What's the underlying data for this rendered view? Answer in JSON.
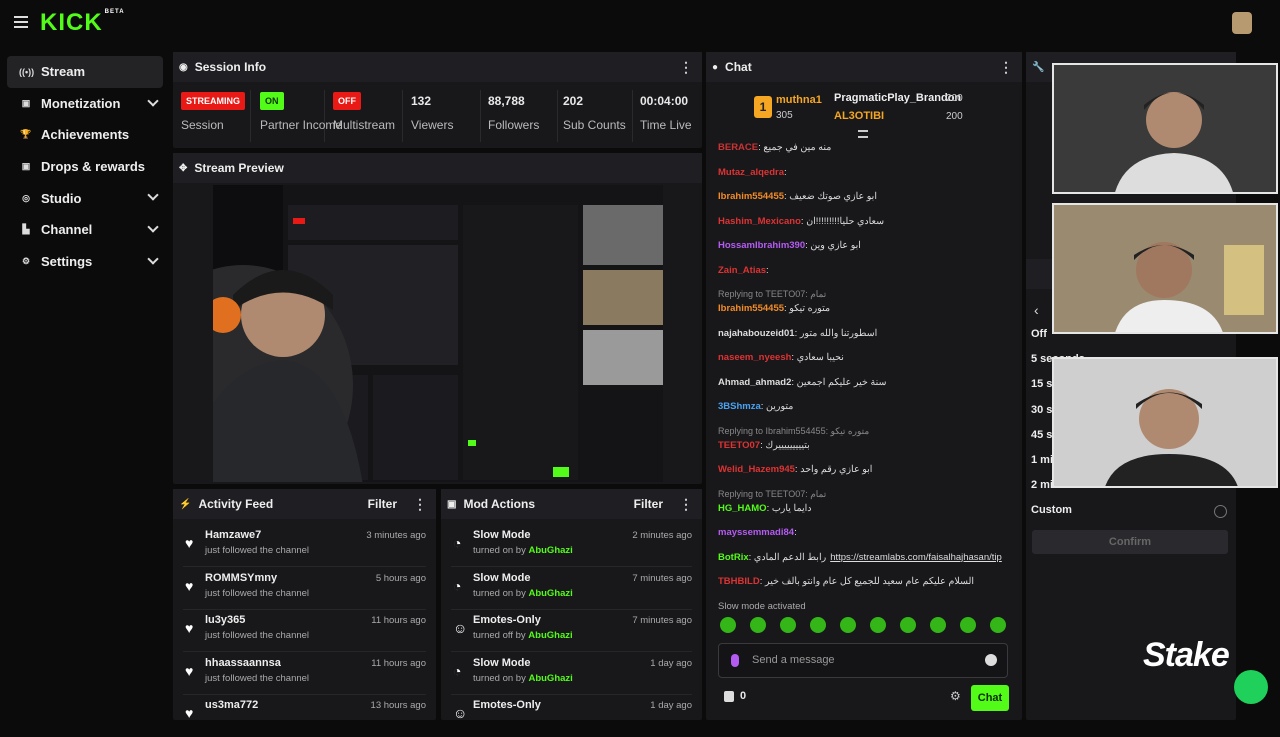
{
  "app": {
    "logo": "KICK",
    "beta": "BETA"
  },
  "sidebar": {
    "items": [
      {
        "label": "Stream",
        "icon": "broadcast-icon",
        "chevron": false
      },
      {
        "label": "Monetization",
        "icon": "money-icon",
        "chevron": true
      },
      {
        "label": "Achievements",
        "icon": "trophy-icon",
        "chevron": false
      },
      {
        "label": "Drops & rewards",
        "icon": "gift-icon",
        "chevron": false
      },
      {
        "label": "Studio",
        "icon": "studio-icon",
        "chevron": true
      },
      {
        "label": "Channel",
        "icon": "channel-icon",
        "chevron": true
      },
      {
        "label": "Settings",
        "icon": "gear-icon",
        "chevron": true
      }
    ]
  },
  "session": {
    "title": "Session Info",
    "stats": [
      {
        "value": "STREAMING",
        "label": "Session",
        "kind": "badge-red"
      },
      {
        "value": "ON",
        "label": "Partner Income",
        "kind": "badge-green"
      },
      {
        "value": "OFF",
        "label": "Multistream",
        "kind": "badge-red"
      },
      {
        "value": "132",
        "label": "Viewers",
        "kind": "text"
      },
      {
        "value": "88,788",
        "label": "Followers",
        "kind": "text"
      },
      {
        "value": "202",
        "label": "Sub Counts",
        "kind": "text"
      },
      {
        "value": "00:04:00",
        "label": "Time Live",
        "kind": "text"
      }
    ]
  },
  "preview": {
    "title": "Stream Preview"
  },
  "activity": {
    "title": "Activity Feed",
    "filter": "Filter",
    "items": [
      {
        "name": "Hamzawe7",
        "action": "just followed the channel",
        "time": "3 minutes ago"
      },
      {
        "name": "ROMMSYmny",
        "action": "just followed the channel",
        "time": "5 hours ago"
      },
      {
        "name": "lu3y365",
        "action": "just followed the channel",
        "time": "11 hours ago"
      },
      {
        "name": "hhaassaannsa",
        "action": "just followed the channel",
        "time": "11 hours ago"
      },
      {
        "name": "us3ma772",
        "action": "",
        "time": "13 hours ago"
      }
    ]
  },
  "mod": {
    "title": "Mod Actions",
    "filter": "Filter",
    "items": [
      {
        "name": "Slow Mode",
        "action": "turned on by",
        "by": "AbuGhazi",
        "time": "2 minutes ago"
      },
      {
        "name": "Slow Mode",
        "action": "turned on by",
        "by": "AbuGhazi",
        "time": "7 minutes ago"
      },
      {
        "name": "Emotes-Only",
        "action": "turned off by",
        "by": "AbuGhazi",
        "time": "7 minutes ago"
      },
      {
        "name": "Slow Mode",
        "action": "turned on by",
        "by": "AbuGhazi",
        "time": "1 day ago"
      },
      {
        "name": "Emotes-Only",
        "action": "",
        "by": "",
        "time": "1 day ago"
      }
    ]
  },
  "chat": {
    "title": "Chat",
    "pinned": {
      "rank": "1",
      "user1": "muthna1",
      "user1_count": "305",
      "user2": "PragmaticPlay_Brandon",
      "user2_count": "200",
      "user3": "AL3OTIBI",
      "user3_count": "200"
    },
    "messages": [
      {
        "user": "BERACE",
        "color": "#c33",
        "text": "منه مين في جميع",
        "reply": ""
      },
      {
        "user": "Mutaz_alqedra",
        "color": "#d33",
        "text": "",
        "reply": ""
      },
      {
        "user": "Ibrahim554455",
        "color": "#f28c28",
        "text": "ابو عازي صوتك ضعيف",
        "reply": ""
      },
      {
        "user": "Hashim_Mexicano",
        "color": "#d33",
        "text": "سعادي حليا!!!!!!!!!ان",
        "reply": ""
      },
      {
        "user": "HossamIbrahim390",
        "color": "#b45cf2",
        "text": "ابو عازي وين",
        "reply": ""
      },
      {
        "user": "Zain_Atias",
        "color": "#d33",
        "text": "",
        "reply": ""
      },
      {
        "user": "Ibrahim554455",
        "color": "#f28c28",
        "text": "متوره تيكو",
        "reply": "Replying to TEETO07: تمام"
      },
      {
        "user": "najahabouzeid01",
        "color": "#ddd",
        "text": "اسطورتنا والله متور",
        "reply": ""
      },
      {
        "user": "naseem_nyeesh",
        "color": "#d33",
        "text": "نحيبا سعادي",
        "reply": ""
      },
      {
        "user": "Ahmad_ahmad2",
        "color": "#ddd",
        "text": "سنة خير عليكم اجمعين",
        "reply": ""
      },
      {
        "user": "3BShmza",
        "color": "#4aa3f2",
        "text": "متورين",
        "reply": ""
      },
      {
        "user": "TEETO07",
        "color": "#d33",
        "text": "بتيييييييييرك",
        "reply": "Replying to Ibrahim554455: متوره تيكو"
      },
      {
        "user": "Welid_Hazem945",
        "color": "#d33",
        "text": "ابو عازي رقم واحد",
        "reply": ""
      },
      {
        "user": "HG_HAMO",
        "color": "#53fc18",
        "text": "دايما يارب",
        "reply": "Replying to TEETO07: تمام"
      },
      {
        "user": "mayssemmadi84",
        "color": "#b45cf2",
        "text": "",
        "reply": ""
      },
      {
        "user": "BotRix",
        "color": "#53fc18",
        "text": "رابط الدعم المادي",
        "link": "https://streamlabs.com/faisalhajhasan/tip",
        "reply": ""
      },
      {
        "user": "TBHBILD",
        "color": "#d33",
        "text": "السلام عليكم عام سعيد للجميع كل عام وانتو بألف خير",
        "reply": ""
      }
    ],
    "slow_mode": "Slow mode activated",
    "placeholder": "Send a message",
    "points": "0",
    "send_label": "Chat"
  },
  "right": {
    "options": [
      "Off",
      "5 seconds",
      "15 seconds",
      "30 seconds",
      "45 seconds",
      "1 minute",
      "2 minutes",
      "Custom"
    ],
    "confirm": "Confirm"
  },
  "overlay": {
    "brand": "Stake"
  },
  "colors": {
    "accent": "#53fc18",
    "red": "#e91916",
    "panel": "#18181b"
  }
}
